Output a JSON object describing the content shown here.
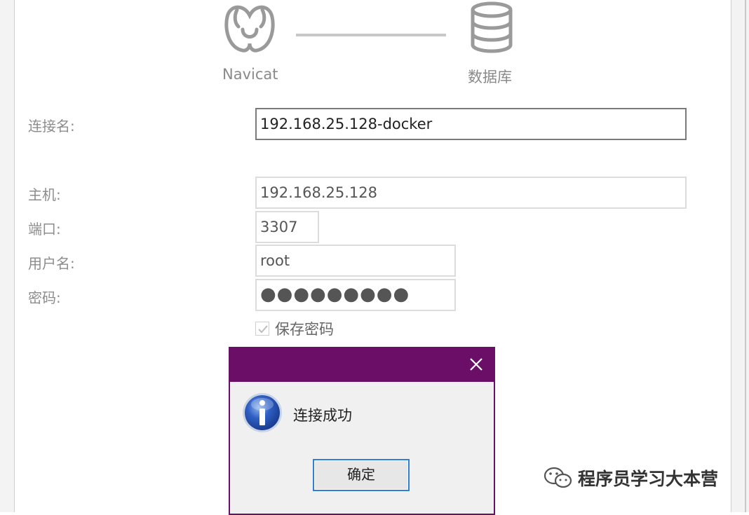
{
  "diagram": {
    "left_label": "Navicat",
    "right_label": "数据库",
    "left_icon": "navicat-logo-icon",
    "right_icon": "database-icon"
  },
  "form": {
    "connection_name_label": "连接名:",
    "connection_name_value": "192.168.25.128-docker",
    "host_label": "主机:",
    "host_value": "192.168.25.128",
    "port_label": "端口:",
    "port_value": "3307",
    "username_label": "用户名:",
    "username_value": "root",
    "password_label": "密码:",
    "password_value": "●●●●●●●●●",
    "save_password_label": "保存密码",
    "save_password_checked": true
  },
  "dialog": {
    "titlebar_color": "#6b0e67",
    "icon": "info-icon",
    "message": "连接成功",
    "ok_label": "确定"
  },
  "watermark": {
    "icon": "wechat-icon",
    "text": "程序员学习大本营"
  }
}
